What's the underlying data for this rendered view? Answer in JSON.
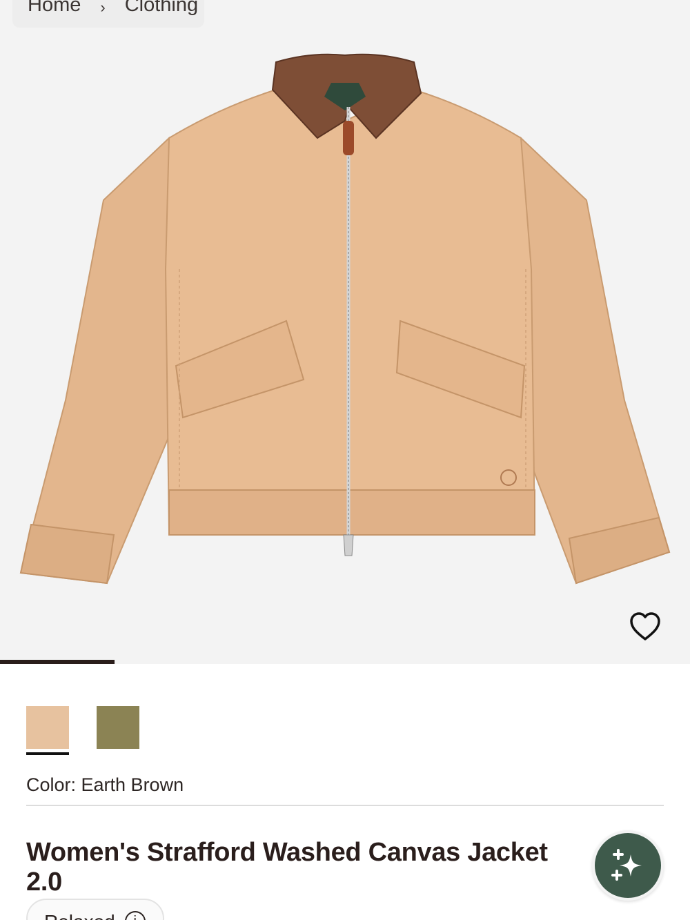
{
  "breadcrumb": {
    "home": "Home",
    "separator": "›",
    "current": "Clothing"
  },
  "gallery": {
    "image_alt": "Women's Strafford Washed Canvas Jacket 2.0 in Earth Brown",
    "image_count_progress": 0.166
  },
  "wishlist": {
    "icon": "heart-outline-icon"
  },
  "swatches": [
    {
      "name": "Earth Brown",
      "color": "#e7c29f",
      "selected": true
    },
    {
      "name": "Olive",
      "color": "#8b8354",
      "selected": false
    }
  ],
  "color_row": {
    "text": "Color: Earth Brown"
  },
  "product": {
    "title": "Women's Strafford Washed Canvas Jacket 2.0"
  },
  "ai_assistant": {
    "icon": "sparkle-icon"
  },
  "fit_chip": {
    "label": "Relaxed",
    "icon": "info-icon"
  }
}
